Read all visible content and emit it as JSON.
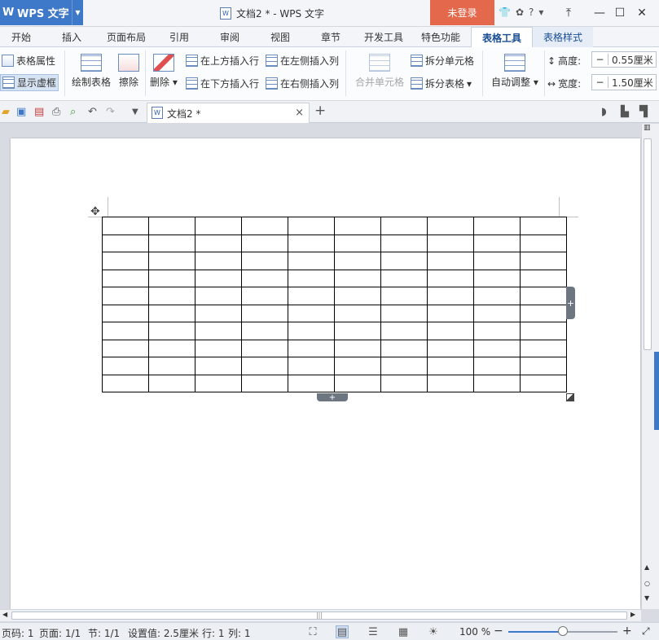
{
  "titlebar": {
    "app_logo": "W",
    "app_name": "WPS 文字",
    "doc_title": "文档2 * - WPS 文字",
    "login_label": "未登录",
    "help_label": "?",
    "icons": [
      "shirt-icon",
      "chat-icon",
      "help-icon",
      "share-icon",
      "minimize-icon",
      "maximize-icon",
      "close-icon"
    ]
  },
  "tabs": [
    {
      "label": "开始"
    },
    {
      "label": "插入"
    },
    {
      "label": "页面布局"
    },
    {
      "label": "引用"
    },
    {
      "label": "审阅"
    },
    {
      "label": "视图"
    },
    {
      "label": "章节"
    },
    {
      "label": "开发工具"
    },
    {
      "label": "特色功能"
    },
    {
      "label": "表格工具",
      "active": true
    },
    {
      "label": "表格样式"
    }
  ],
  "ribbon": {
    "table_props": "表格属性",
    "show_gridlines": "显示虚框",
    "draw_table": "绘制表格",
    "erase": "擦除",
    "delete": "删除",
    "insert_above": "在上方插入行",
    "insert_below": "在下方插入行",
    "insert_left": "在左侧插入列",
    "insert_right": "在右侧插入列",
    "merge_cells": "合并单元格",
    "split_cells": "拆分单元格",
    "split_table": "拆分表格",
    "auto_adjust": "自动调整",
    "height_label": "高度:",
    "height_value": "0.55厘米",
    "width_label": "宽度:",
    "width_value": "1.50厘米"
  },
  "doc_tab": {
    "label": "文档2 *",
    "close": "×",
    "new": "+"
  },
  "document": {
    "table_rows": 10,
    "table_cols": 10
  },
  "status": {
    "page_code": "页码: 1",
    "page": "页面: 1/1",
    "section": "节: 1/1",
    "setting": "设置值: 2.5厘米",
    "row": "行: 1",
    "col": "列: 1",
    "zoom": "100 %",
    "zoom_fraction": 0.5
  }
}
